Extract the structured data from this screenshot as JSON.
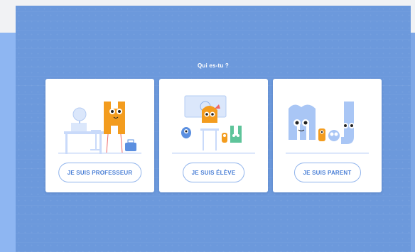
{
  "header": {
    "question": "Qui es-tu ?"
  },
  "roles": [
    {
      "label": "JE SUIS PROFESSEUR",
      "illustration": "teacher-monster-illustration"
    },
    {
      "label": "JE SUIS ÉLÈVE",
      "illustration": "student-monster-illustration"
    },
    {
      "label": "JE SUIS PARENT",
      "illustration": "parent-monster-illustration"
    }
  ],
  "colors": {
    "background": "#6c99dc",
    "card": "#ffffff",
    "accent": "#4a7fd6",
    "monster_orange": "#f39c1e",
    "monster_blue": "#a9c6f5"
  }
}
